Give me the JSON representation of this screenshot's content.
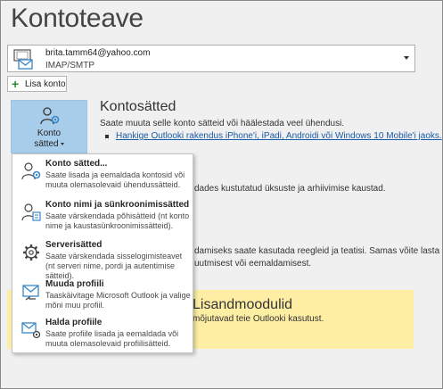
{
  "page": {
    "title": "Kontoteave"
  },
  "account": {
    "email": "brita.tamm64@yahoo.com",
    "type": "IMAP/SMTP"
  },
  "add_account": {
    "label": "Lisa konto"
  },
  "settings_button": {
    "line1": "Konto",
    "line2": "sätted"
  },
  "settings_section": {
    "title": "Kontosätted",
    "description": "Saate muuta selle konto sätteid või häälestada veel ühendusi.",
    "link": "Hankige Outlooki rakendus iPhone'i, iPadi, Androidi või Windows 10 Mobile'i jaoks."
  },
  "background_text": {
    "mailbox_fragment": "dades kustutatud üksuste ja arhiivimise kaustad.",
    "rules_fragment_1": "damiseks saate kasutada reegleid ja teatisi. Samas võite lasta",
    "rules_fragment_2": "uutmisest või eemaldamisest."
  },
  "addins": {
    "title": "Lisandmoodulid",
    "description": "mõjutavad teie Outlooki kasutust."
  },
  "menu": {
    "items": [
      {
        "title": "Konto sätted...",
        "desc": "Saate lisada ja eemaldada kontosid või muuta olemasolevaid ühendussätteid.",
        "icon": "account-settings-icon"
      },
      {
        "title": "Konto nimi ja sünkroonimissätted",
        "desc": "Saate värskendada põhisätteid (nt konto nime ja kaustasünkroonimissätteid).",
        "icon": "account-name-sync-icon"
      },
      {
        "title": "Serverisätted",
        "desc": "Saate värskendada sisselogimisteavet (nt serveri nime, pordi ja autentimise sätteid).",
        "icon": "server-settings-gear-icon"
      },
      {
        "title": "Muuda profiili",
        "desc": "Taaskäivitage Microsoft Outlook ja valige mõni muu profiil.",
        "icon": "change-profile-icon"
      },
      {
        "title": "Halda profiile",
        "desc": "Saate profiile lisada ja eemaldada või muuta olemasolevaid profiilisätteid.",
        "icon": "manage-profiles-icon"
      }
    ]
  },
  "colors": {
    "accent_blue": "#3a86c6",
    "settings_button_bg": "#a8cdeb",
    "addins_bg": "#fdeea4",
    "link": "#1a5aa6"
  }
}
